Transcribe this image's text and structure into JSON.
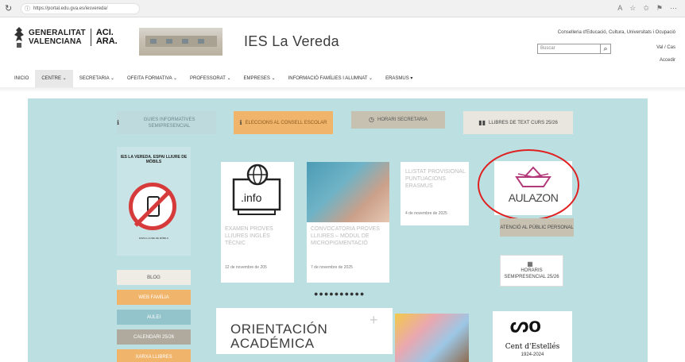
{
  "browser": {
    "url": "https://portal.edu.gva.es/iesvereda/"
  },
  "header": {
    "gva_line1": "GENERALITAT",
    "gva_line2": "VALENCIANA",
    "aci_line1": "ACI.",
    "aci_line2": "ARA.",
    "school_title": "IES La Vereda",
    "conselleria": "Conselleria d'Educació, Cultura, Universitats i Ocupació",
    "search_placeholder": "Buscar",
    "lang": "Val / Cas",
    "access": "Accedir"
  },
  "nav": {
    "items": [
      "INICIO",
      "CENTRE ⌄",
      "SECRETARIA ⌄",
      "OFEITA FORMATIVA ⌄",
      "PROFESSORAT ⌄",
      "EMPRESES ⌄",
      "INFORMACIÓ FAMÍLIES I ALUMNAT ⌄",
      "ERASMUS ▾"
    ]
  },
  "tiles": {
    "guies": "GUIES INFORMATIVES SEMIPRESENCIAL",
    "eleccions": "ELECCIONS AL CONSELL ESCOLAR",
    "horari": "HORARI SECRETARIA",
    "llibres": "LLIBRES DE TEXT CURS 25/26",
    "atencio": "ATENCIÓ AL PÚBLIC PERSONAL",
    "horaris": "HORARIS SEMIPRESENCIAL 25/26"
  },
  "poster": {
    "title": "IES LA VEREDA. ESPAI LLIURE DE MÒBILS",
    "caption": "ESPAI LLIURE DE MÒBILS"
  },
  "cards": {
    "card1_text": "EXAMEN PROVES LLIURES INGLÉS TÈCNIC",
    "card1_date": "12 de novembre de 205",
    "card2_text": "CONVOCATORIA PROVES LLIURES – MÒDUL DE Micropigmentació",
    "card2_date": "7 de novembre de 2025",
    "card3_text": "LLISTAT PROVISIONAL PUNTUACIONS ERASMUS",
    "card3_date": "4 de novembre de 2025"
  },
  "aulazon": "AULAZON",
  "dots": "●●●●●●●●●●",
  "side_buttons": {
    "blog": "BLOG",
    "web": "WEB FAMÍLIA",
    "aulei": "AULEI",
    "cal": "CALENDARI 25/26",
    "xarxa": "XARXA LLIBRES"
  },
  "orientacio": {
    "line1": "ORIENTACIÓN",
    "line2": "ACADÉMICA"
  },
  "cent": {
    "logo": "ᔕo",
    "name": "Cent d'Estellés",
    "years": "1924-2024"
  },
  "colors": {
    "main_bg": "#bcdfe2",
    "orange": "#f0b46a",
    "highlight": "#e02020"
  }
}
